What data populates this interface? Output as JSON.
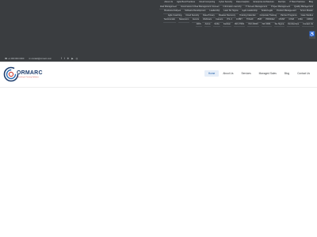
{
  "mega_menu": {
    "links": [
      "About Us",
      "Agile Best Practices",
      "Cloud Computing",
      "Cyber Security",
      "Data Analytics",
      "Enterprise Architecture",
      "DevOps",
      "IT Best Practices",
      "Blog",
      "Risk Management",
      "Governance & Risk Management Courses",
      "Information Security",
      "IT Service Management",
      "Project Management",
      "Quality Management",
      "Business Analysis",
      "Software Development",
      "Leadership",
      "Lean Six Sigma",
      "Agile Leadership",
      "Scaled Agile",
      "Product Management",
      "Scrum Master",
      "Agile Coaching",
      "Cloud Security",
      "Data Privacy",
      "Disaster Recovery",
      "Training Calendar",
      "Corporate Training",
      "Partner Programs",
      "Case Studies",
      "Testimonials",
      "Newsroom",
      "Events",
      "Webinars",
      "Careers",
      "ITIL 4",
      "COBIT",
      "TOGAF",
      "PMP",
      "PRINCE2",
      "CISSP",
      "CISM",
      "CISA",
      "CRISC",
      "AWS",
      "Azure",
      "SAFe",
      "Kanban",
      "ISO 27001",
      "ISO 20000",
      "ISO 9001",
      "Six Sigma",
      "DevSecOps",
      "Contact Us"
    ]
  },
  "topbar": {
    "phone": "☎ +1 000 000 0000",
    "email": "✉ contact@ormarc.com"
  },
  "logo": {
    "name": "ORMARC",
    "tagline": "Consulting & Training Solutions"
  },
  "nav": {
    "items": [
      {
        "label": "Home",
        "active": true
      },
      {
        "label": "About Us"
      },
      {
        "label": "Services"
      },
      {
        "label": "Managed Sales"
      },
      {
        "label": "Blog"
      },
      {
        "label": "Contact Us"
      }
    ]
  },
  "colors": {
    "mega_bg": "#3a3d40",
    "brand_blue": "#1f3f6e",
    "brand_red": "#d04a3f",
    "active_bg": "#e6eef8"
  }
}
